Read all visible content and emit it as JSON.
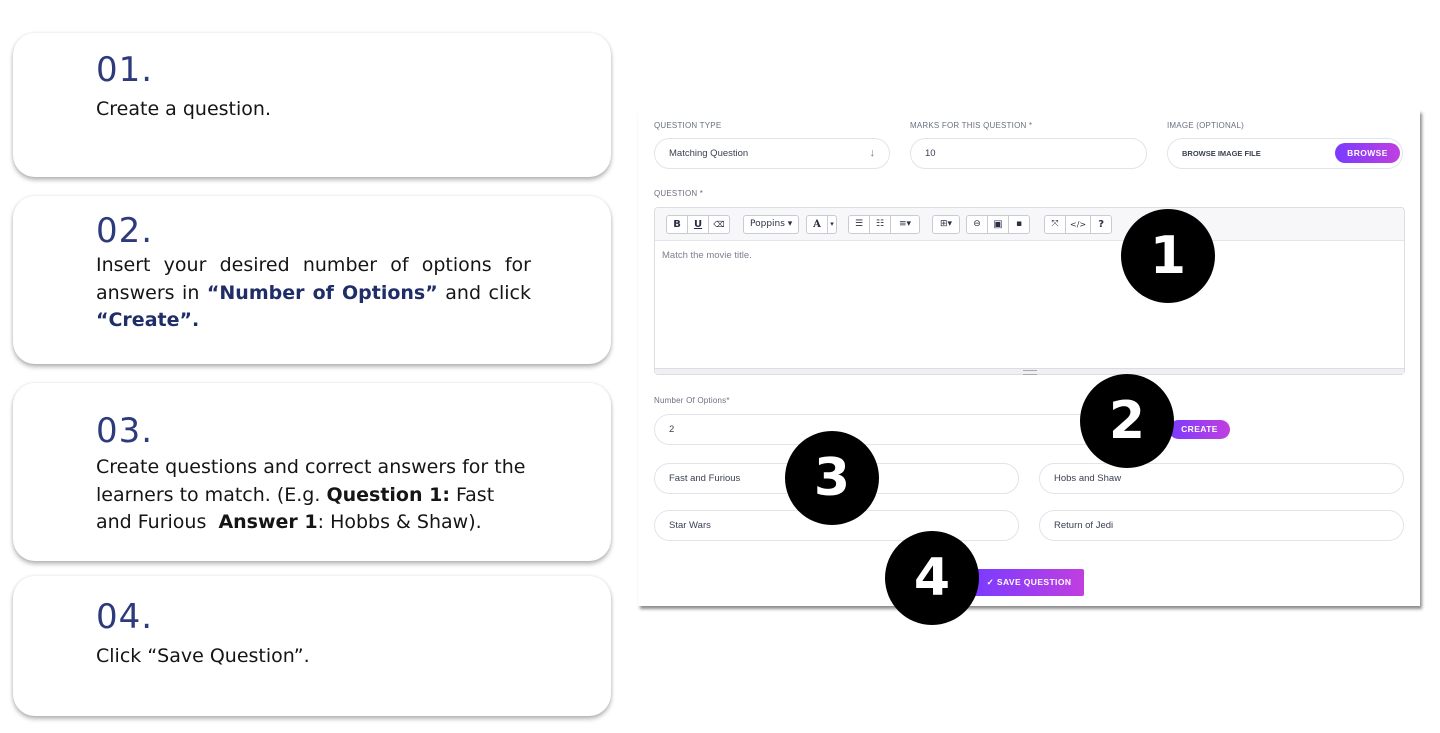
{
  "steps": [
    {
      "num": "01.",
      "text": "Create a question."
    },
    {
      "num": "02.",
      "text_before": "Insert your desired number of options for answers in ",
      "highlight1": "“Number of Options”",
      "text_middle": " and click ",
      "highlight2": "“Create”."
    },
    {
      "num": "03.",
      "text_before": "Create questions and correct answers for the learners to match. (E.g. ",
      "bold1": "Question 1:",
      "text_middle": " Fast and Furious  ",
      "bold2": "Answer 1",
      "text_after": ": Hobbs & Shaw)."
    },
    {
      "num": "04.",
      "text": "Click “Save Question”."
    }
  ],
  "form": {
    "question_type_label": "QUESTION TYPE",
    "question_type_value": "Matching Question",
    "marks_label": "MARKS FOR THIS QUESTION *",
    "marks_value": "10",
    "image_label": "IMAGE (OPTIONAL)",
    "image_placeholder": "BROWSE IMAGE FILE",
    "browse_label": "BROWSE",
    "question_label": "QUESTION *",
    "toolbar": {
      "bold": "B",
      "underline": "U",
      "eraser": "⌫",
      "font": "Poppins ▾",
      "text_color": "A",
      "color_caret": "▾",
      "ul": "☰",
      "ol": "☷",
      "align": "≡▾",
      "table": "⊞▾",
      "link": "⊖",
      "image": "▣",
      "video": "▪",
      "fullscreen": "⤧",
      "code": "</>",
      "help": "?"
    },
    "question_text": "Match the movie title.",
    "num_options_label": "Number Of Options*",
    "num_options_value": "2",
    "create_label": "CREATE",
    "options": [
      {
        "question": "Fast and Furious",
        "answer": "Hobs and Shaw"
      },
      {
        "question": "Star Wars",
        "answer": "Return of Jedi"
      }
    ],
    "save_label": "✓ SAVE QUESTION"
  },
  "markers": [
    "1",
    "2",
    "3",
    "4"
  ],
  "colors": {
    "step_number": "#2d3a7c",
    "highlight": "#1f2d68",
    "button_gradient_start": "#7a3bff",
    "button_gradient_end": "#c03fe0"
  }
}
